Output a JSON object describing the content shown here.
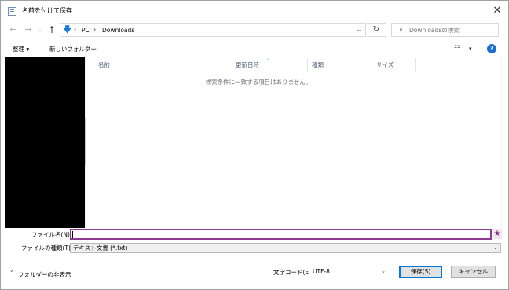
{
  "window": {
    "title": "名前を付けて保存",
    "close_glyph": "✕"
  },
  "nav": {
    "back_glyph": "←",
    "forward_glyph": "→",
    "history_glyph": "⌄",
    "up_glyph": "↑",
    "location_icon": "download-arrow-icon",
    "breadcrumbs": [
      "PC",
      "Downloads"
    ],
    "breadcrumb_sep": "›",
    "address_dropdown_glyph": "⌄",
    "refresh_glyph": "↻",
    "search_placeholder": "Downloadsの検索"
  },
  "toolbar": {
    "organize": "整理 ▾",
    "new_folder": "新しいフォルダー",
    "view_glyph": "☷",
    "view_drop": "▾",
    "help": "?"
  },
  "columns": [
    "名前",
    "更新日時",
    "種類",
    "サイズ"
  ],
  "sort_glyph": "⌄",
  "empty_message": "検索条件に一致する項目はありません。",
  "form": {
    "filename_label": "ファイル名(N):",
    "filename_value": "",
    "star_glyph": "★",
    "filetype_label": "ファイルの種類(T):",
    "filetype_value": "テキスト文書 (*.txt)",
    "drop_glyph": "⌄"
  },
  "footer": {
    "hide_folders": "フォルダーの非表示",
    "hide_chevron": "⌃",
    "encoding_label": "文字コード(E):",
    "encoding_value": "UTF-8",
    "encoding_drop": "⌄",
    "save": "保存(S)",
    "cancel": "キャンセル"
  },
  "colors": {
    "accent": "#0078d7",
    "highlight_border": "#8b3a8f",
    "help_blue": "#1a6fd1"
  }
}
